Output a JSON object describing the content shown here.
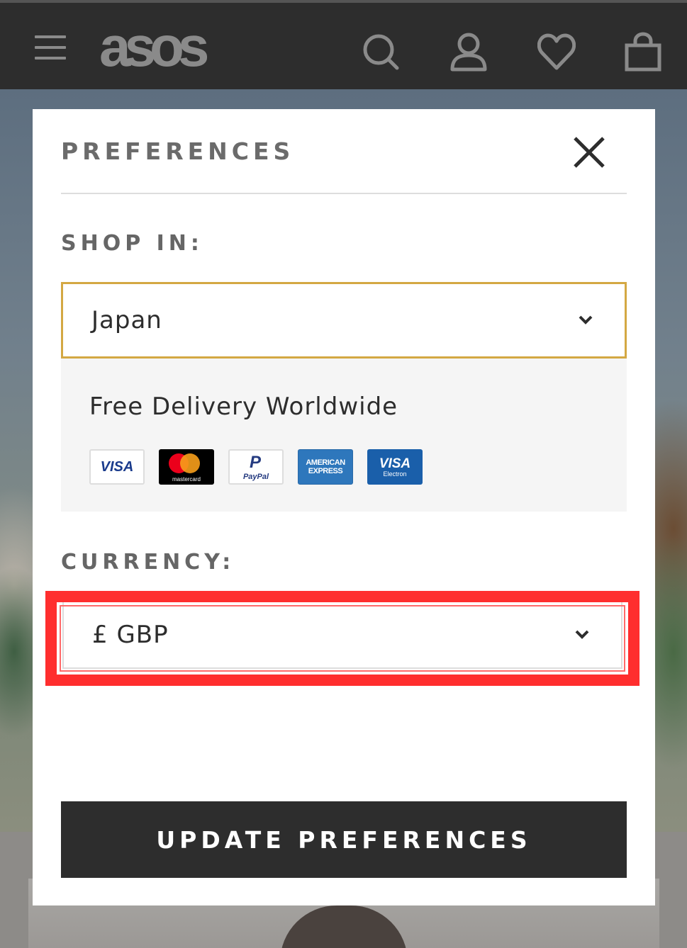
{
  "header": {
    "logo": "asos",
    "icons": [
      "menu-icon",
      "search-icon",
      "account-icon",
      "heart-icon",
      "bag-icon"
    ]
  },
  "modal": {
    "title": "PREFERENCES",
    "shop_in": {
      "label": "SHOP IN:",
      "selected": "Japan"
    },
    "delivery": {
      "text": "Free Delivery Worldwide",
      "payment_methods": [
        {
          "name": "visa",
          "label": "VISA"
        },
        {
          "name": "mastercard",
          "label": "mastercard"
        },
        {
          "name": "paypal",
          "label": "PayPal"
        },
        {
          "name": "american-express",
          "label_line1": "AMERICAN",
          "label_line2": "EXPRESS"
        },
        {
          "name": "visa-electron",
          "label_line1": "VISA",
          "label_line2": "Electron"
        }
      ]
    },
    "currency": {
      "label": "CURRENCY:",
      "selected": "£ GBP"
    },
    "submit_label": "UPDATE PREFERENCES"
  },
  "colors": {
    "header_bg": "#2d2d2d",
    "focus_border": "#d4a843",
    "highlight": "#ff2e2e",
    "button_bg": "#2d2d2d"
  }
}
